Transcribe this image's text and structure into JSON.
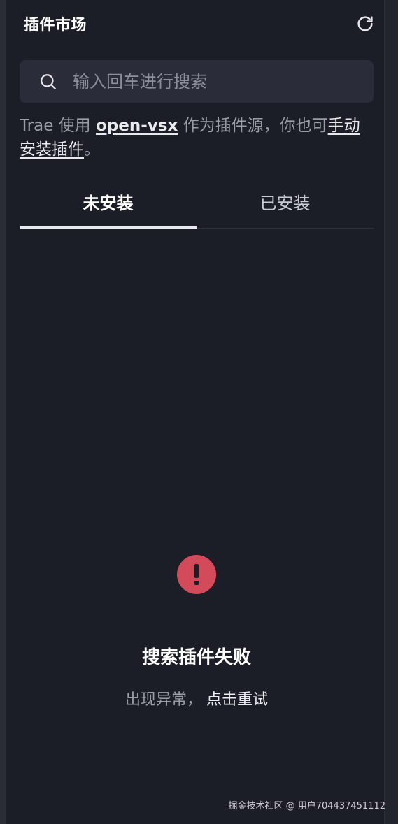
{
  "header": {
    "title": "插件市场",
    "refresh_icon": "refresh-icon"
  },
  "search": {
    "placeholder": "输入回车进行搜索",
    "value": "",
    "icon": "search-icon"
  },
  "description": {
    "prefix": "Trae 使用 ",
    "link_source": "open-vsx",
    "middle": " 作为插件源，你也可",
    "link_manual": "手动安装插件",
    "suffix": "。"
  },
  "tabs": [
    {
      "label": "未安装",
      "active": true
    },
    {
      "label": "已安装",
      "active": false
    }
  ],
  "empty_state": {
    "icon": "exclamation-icon",
    "title": "搜索插件失败",
    "subtitle": "出现异常，",
    "retry_label": "点击重试"
  },
  "watermark": "掘金技术社区 @ 用户704437451112",
  "colors": {
    "background": "#1b1d27",
    "search_bg": "#2a2d39",
    "error": "#d34a5a",
    "muted_text": "#9a9da8"
  }
}
